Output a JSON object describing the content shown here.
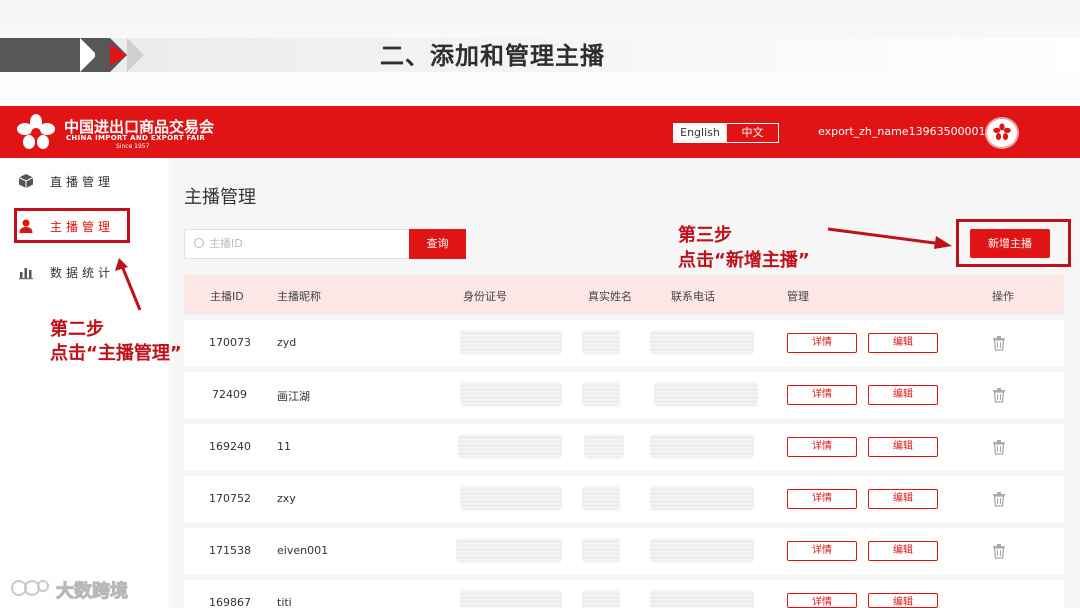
{
  "slide": {
    "title": "二、添加和管理主播",
    "step2_line1": "第二步",
    "step2_line2": "点击“主播管理”",
    "step3_line1": "第三步",
    "step3_line2": "点击“新增主播”",
    "watermark": "大数跨境"
  },
  "header": {
    "logo_cn": "中国进出口商品交易会",
    "logo_en": "CHINA IMPORT AND EXPORT FAIR",
    "logo_since": "Since 1957",
    "lang_en": "English",
    "lang_zh": "中文",
    "username": "export_zh_name13963500001",
    "accent": "#e01414"
  },
  "sidebar": {
    "items": [
      {
        "label": "直播管理",
        "icon": "cube-icon",
        "active": false
      },
      {
        "label": "主播管理",
        "icon": "user-icon",
        "active": true
      },
      {
        "label": "数据统计",
        "icon": "bar-chart-icon",
        "active": false
      }
    ]
  },
  "main": {
    "page_title": "主播管理",
    "search_placeholder": "主播ID",
    "search_button": "查询",
    "add_button": "新增主播",
    "columns": [
      "主播ID",
      "主播昵称",
      "身份证号",
      "真实姓名",
      "联系电话",
      "管理",
      "操作"
    ],
    "detail_label": "详情",
    "edit_label": "编辑",
    "rows": [
      {
        "id": "170073",
        "nickname": "zyd"
      },
      {
        "id": "72409",
        "nickname": "画江湖"
      },
      {
        "id": "169240",
        "nickname": "11"
      },
      {
        "id": "170752",
        "nickname": "zxy"
      },
      {
        "id": "171538",
        "nickname": "eiven001"
      },
      {
        "id": "169867",
        "nickname": "titi"
      }
    ]
  }
}
